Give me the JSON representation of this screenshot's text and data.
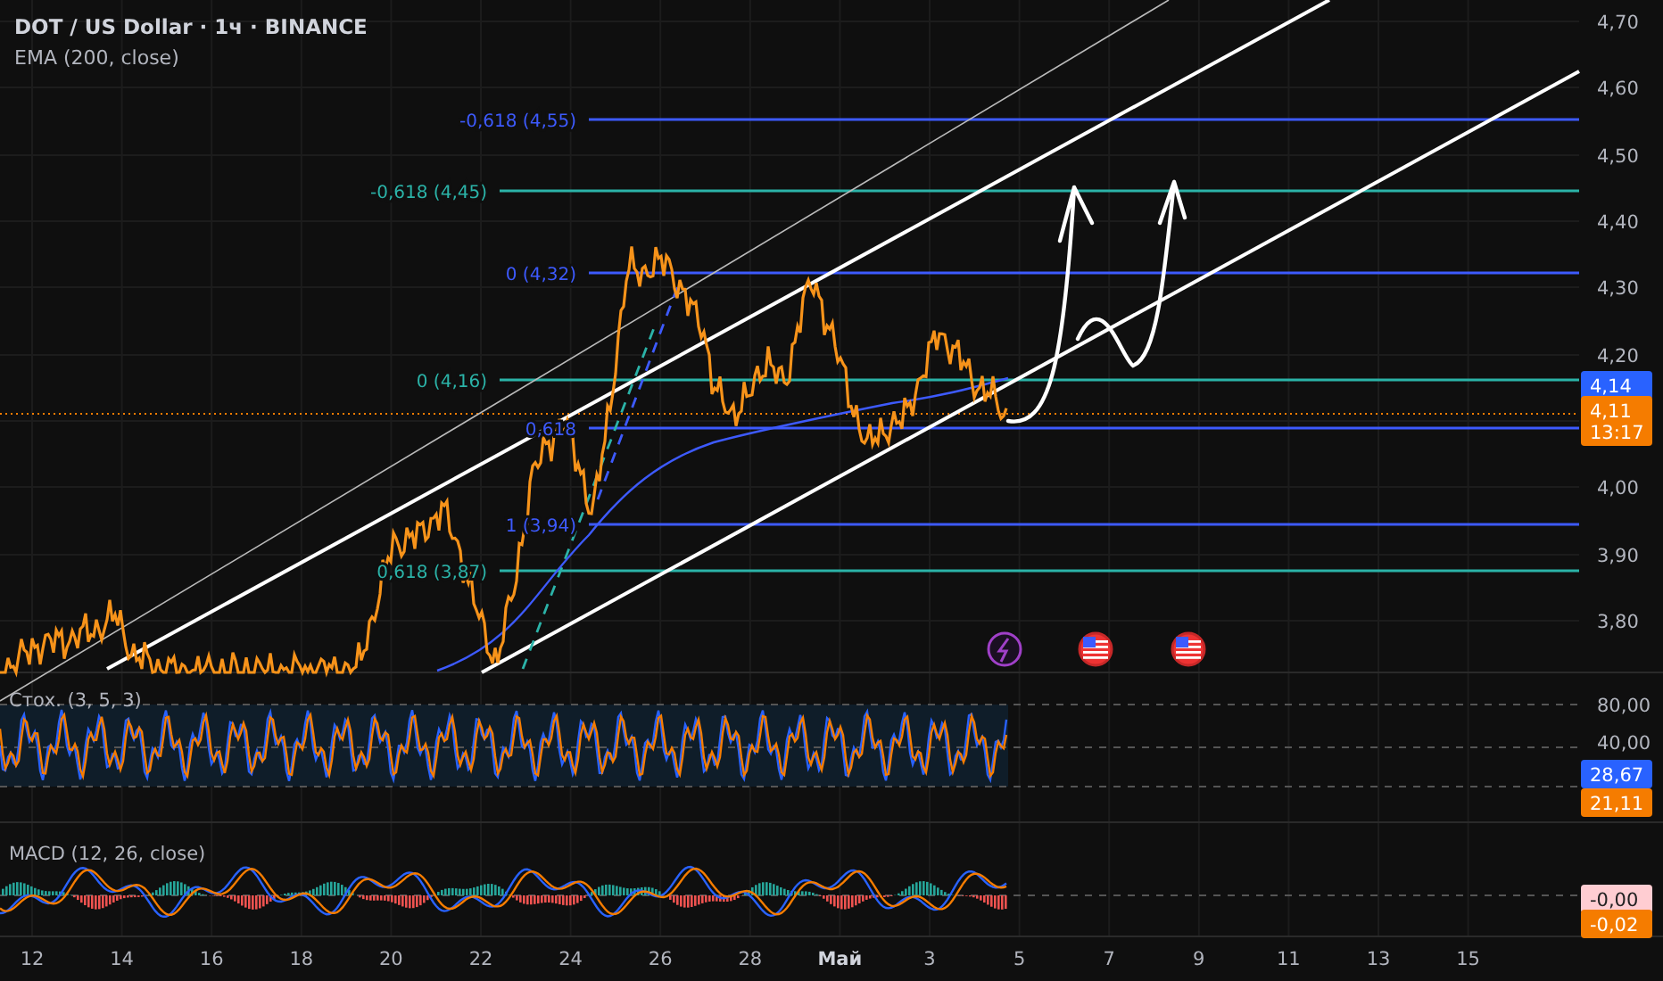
{
  "header": {
    "title": "DOT / US Dollar · 1ч · BINANCE",
    "indicator": "EMA (200, close)"
  },
  "fib_levels": [
    {
      "label": "-0,618 (4,55)",
      "color": "#3d5afe"
    },
    {
      "label": "-0,618 (4,45)",
      "color": "#2bb3a8"
    },
    {
      "label": "0 (4,32)",
      "color": "#3d5afe"
    },
    {
      "label": "0 (4,16)",
      "color": "#2bb3a8"
    },
    {
      "label": "0,618",
      "color": "#3d5afe"
    },
    {
      "label": "1 (3,94)",
      "color": "#3d5afe"
    },
    {
      "label": "0,618 (3,87)",
      "color": "#2bb3a8"
    }
  ],
  "events": [
    {
      "kind": "lightning"
    },
    {
      "kind": "us-flag"
    },
    {
      "kind": "us-flag"
    }
  ],
  "price_axis": {
    "labels": [
      "4,70",
      "4,60",
      "4,50",
      "4,40",
      "4,30",
      "4,20",
      "4,00",
      "3,90",
      "3,80"
    ],
    "badges": [
      {
        "lines": [
          "4,14"
        ],
        "color": "#2962ff"
      },
      {
        "lines": [
          "4,11",
          "13:17"
        ],
        "color": "#f57c00"
      }
    ]
  },
  "stoch": {
    "label": "Стох. (3, 5, 3)",
    "axis_labels": [
      "80,00",
      "40,00"
    ],
    "badges": [
      {
        "lines": [
          "28,67"
        ],
        "color": "#2962ff"
      },
      {
        "lines": [
          "21,11"
        ],
        "color": "#f57c00"
      }
    ]
  },
  "macd": {
    "label": "MACD (12, 26, close)",
    "badges": [
      {
        "lines": [
          "-0,00"
        ],
        "color": "#ffcdd2"
      },
      {
        "lines": [
          "-0,02"
        ],
        "color": "#f57c00"
      }
    ]
  },
  "time_axis": [
    {
      "label": "12",
      "bold": false
    },
    {
      "label": "14",
      "bold": false
    },
    {
      "label": "16",
      "bold": false
    },
    {
      "label": "18",
      "bold": false
    },
    {
      "label": "20",
      "bold": false
    },
    {
      "label": "22",
      "bold": false
    },
    {
      "label": "24",
      "bold": false
    },
    {
      "label": "26",
      "bold": false
    },
    {
      "label": "28",
      "bold": false
    },
    {
      "label": "Май",
      "bold": true
    },
    {
      "label": "3",
      "bold": false
    },
    {
      "label": "5",
      "bold": false
    },
    {
      "label": "7",
      "bold": false
    },
    {
      "label": "9",
      "bold": false
    },
    {
      "label": "11",
      "bold": false
    },
    {
      "label": "13",
      "bold": false
    },
    {
      "label": "15",
      "bold": false
    }
  ]
}
